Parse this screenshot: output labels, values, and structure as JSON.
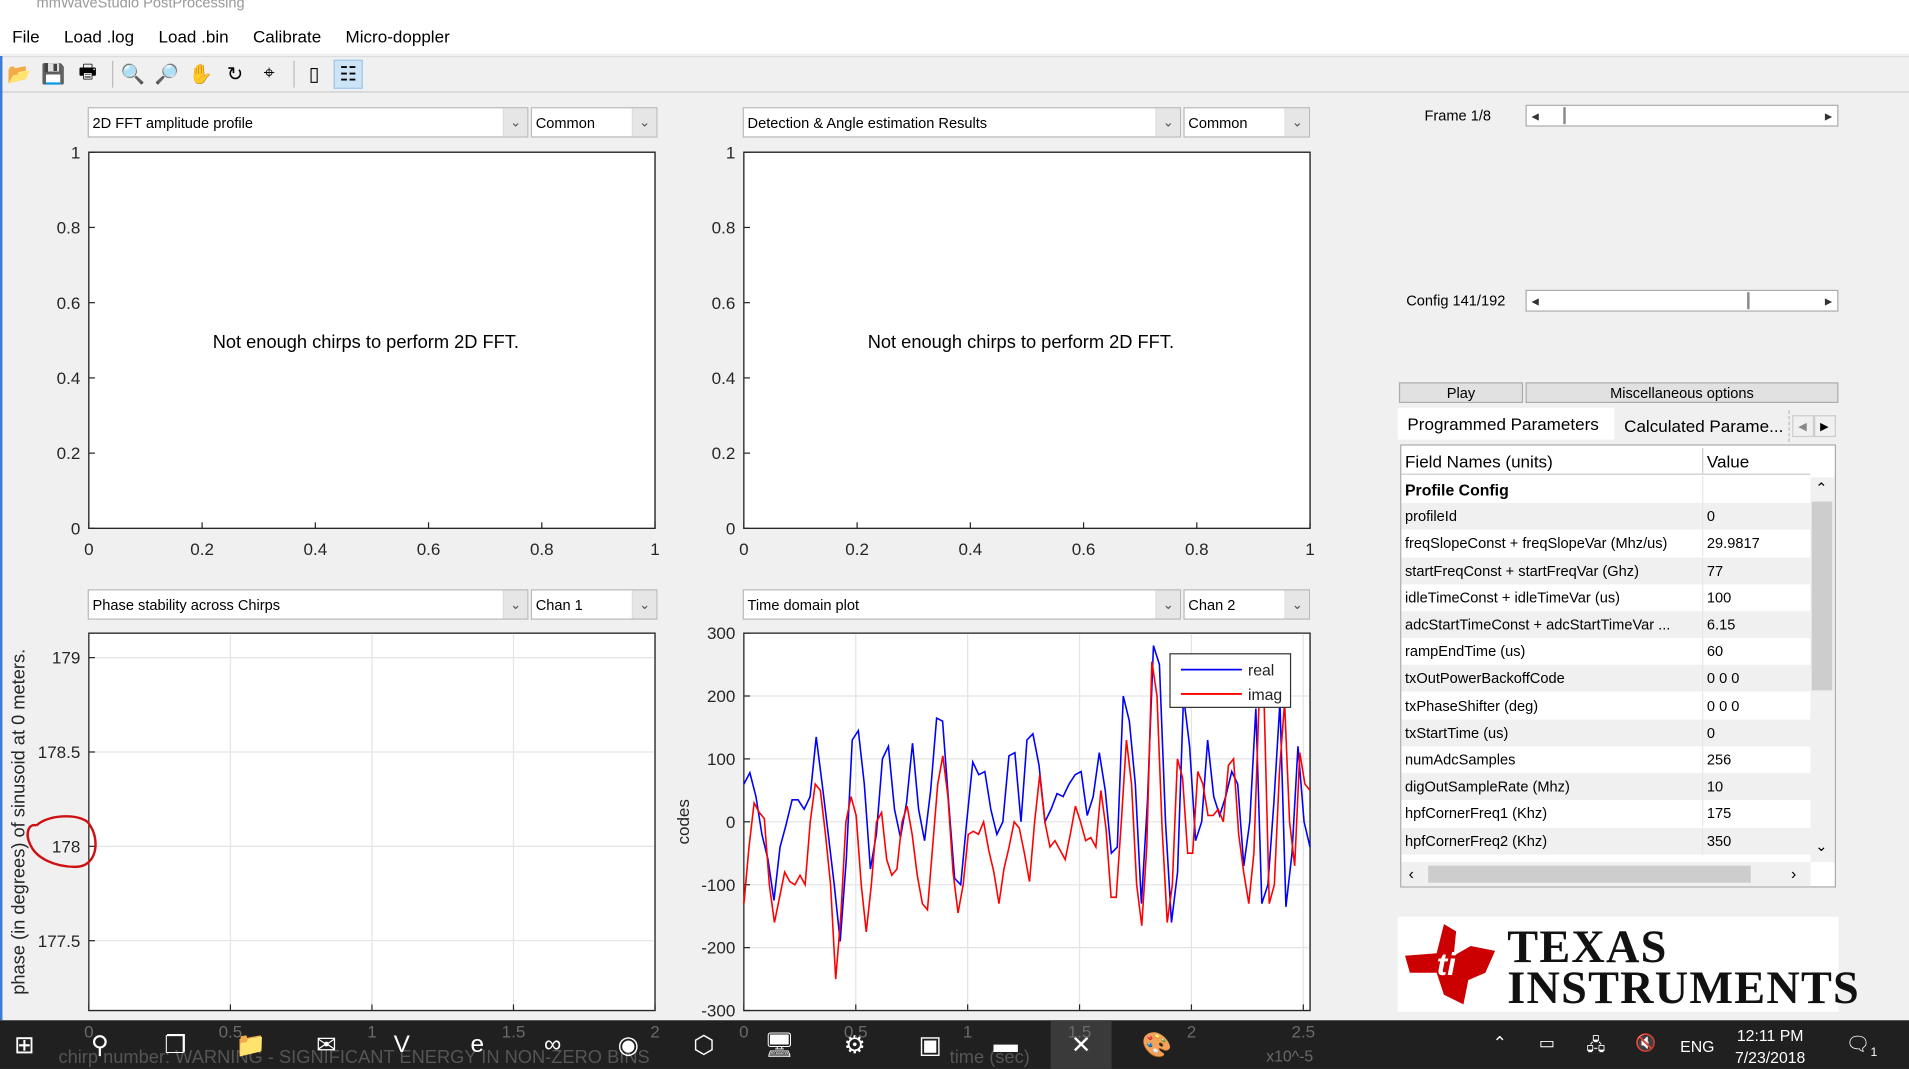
{
  "window": {
    "title": "mmWaveStudio PostProcessing"
  },
  "menu": [
    "File",
    "Load .log",
    "Load .bin",
    "Calibrate",
    "Micro-doppler"
  ],
  "toolbar": [
    {
      "icon": "open-folder-icon",
      "glyph": "📂"
    },
    {
      "icon": "save-icon",
      "glyph": "💾"
    },
    {
      "icon": "print-icon",
      "glyph": "🖶"
    },
    {
      "icon": "zoom-in-icon",
      "glyph": "🔍"
    },
    {
      "icon": "zoom-out-icon",
      "glyph": "🔎"
    },
    {
      "icon": "pan-hand-icon",
      "glyph": "✋"
    },
    {
      "icon": "rotate-icon",
      "glyph": "↻"
    },
    {
      "icon": "data-cursor-icon",
      "glyph": "⌖"
    },
    {
      "icon": "colorbar-icon",
      "glyph": "▯"
    },
    {
      "icon": "legend-icon",
      "glyph": "☷"
    }
  ],
  "panels": [
    {
      "select": "2D FFT amplitude profile",
      "option": "Common",
      "message": "Not enough chirps to perform 2D FFT.",
      "xticks": [
        "0",
        "0.2",
        "0.4",
        "0.6",
        "0.8",
        "1"
      ],
      "yticks": [
        "0",
        "0.2",
        "0.4",
        "0.6",
        "0.8",
        "1"
      ]
    },
    {
      "select": "Detection & Angle estimation Results",
      "option": "Common",
      "message": "Not enough chirps to perform 2D FFT.",
      "xticks": [
        "0",
        "0.2",
        "0.4",
        "0.6",
        "0.8",
        "1"
      ],
      "yticks": [
        "0",
        "0.2",
        "0.4",
        "0.6",
        "0.8",
        "1"
      ]
    },
    {
      "select": "Phase stability across Chirps",
      "option": "Chan 1",
      "ylabel": "phase (in degrees) of sinusoid at 0  meters.",
      "xlabel": "chirp number: WARNING - SIGNIFICANT ENERGY IN NON-ZERO BINS",
      "xticks": [
        "0",
        "0.5",
        "1",
        "1.5",
        "2"
      ],
      "yticks": [
        "177.5",
        "178",
        "178.5",
        "179"
      ]
    },
    {
      "select": "Time domain plot",
      "option": "Chan 2",
      "ylabel": "codes",
      "xlabel": "time (sec)",
      "exponent": "x10^-5"
    }
  ],
  "chart_data": [
    {
      "type": "line",
      "ylim": [
        0,
        1
      ],
      "xlim": [
        0,
        1
      ],
      "series": [],
      "annotation": "Not enough chirps to perform 2D FFT."
    },
    {
      "type": "line",
      "ylim": [
        0,
        1
      ],
      "xlim": [
        0,
        1
      ],
      "series": [],
      "annotation": "Not enough chirps to perform 2D FFT."
    },
    {
      "type": "line",
      "xlim": [
        0,
        2
      ],
      "ylim": [
        177.13,
        179.13
      ],
      "grid": true,
      "ylabel": "phase (in degrees) of sinusoid at 0  meters.",
      "xlabel": "chirp number: WARNING - SIGNIFICANT ENERGY IN NON-ZERO BINS",
      "series": [],
      "highlight": "red hand-drawn circle around 178 tick"
    },
    {
      "type": "line",
      "xlim": [
        0,
        2.53
      ],
      "ylim": [
        -300,
        300
      ],
      "grid": true,
      "ylabel": "codes",
      "xlabel": "time (sec)",
      "x_scale_note": "x10^-5",
      "yticks": [
        -300,
        -200,
        -100,
        0,
        100,
        200,
        300
      ],
      "xticks": [
        0,
        0.5,
        1,
        1.5,
        2,
        2.5
      ],
      "legend": "top-right",
      "series": [
        {
          "name": "real",
          "color": "#0000ff",
          "values": [
            60,
            78,
            40,
            -20,
            -60,
            -125,
            -40,
            -5,
            35,
            35,
            20,
            40,
            135,
            60,
            -20,
            -100,
            -190,
            -60,
            130,
            145,
            60,
            -75,
            -20,
            100,
            120,
            20,
            -25,
            30,
            125,
            20,
            -30,
            50,
            165,
            160,
            30,
            -90,
            -100,
            0,
            95,
            75,
            80,
            20,
            -20,
            0,
            105,
            110,
            0,
            130,
            140,
            90,
            0,
            20,
            45,
            40,
            60,
            75,
            80,
            10,
            40,
            110,
            50,
            -50,
            -40,
            200,
            160,
            60,
            -130,
            30,
            280,
            250,
            0,
            -160,
            -80,
            200,
            120,
            -30,
            0,
            130,
            40,
            10,
            40,
            80,
            60,
            -70,
            0,
            180,
            -130,
            -100,
            30,
            190,
            -135,
            -50,
            120,
            0,
            -40
          ]
        },
        {
          "name": "imag",
          "color": "#ff0000",
          "values": [
            -130,
            -40,
            30,
            15,
            5,
            -100,
            -160,
            -120,
            -80,
            -95,
            -100,
            -85,
            -100,
            0,
            60,
            50,
            -20,
            -100,
            -250,
            -150,
            0,
            40,
            10,
            -100,
            -175,
            -100,
            0,
            15,
            -60,
            -85,
            -75,
            0,
            25,
            -20,
            -85,
            -130,
            -140,
            -40,
            60,
            105,
            40,
            -80,
            -145,
            -100,
            -20,
            -15,
            -20,
            0,
            -45,
            -80,
            -130,
            -75,
            -40,
            0,
            -10,
            -50,
            -95,
            0,
            75,
            0,
            -40,
            -30,
            -45,
            -60,
            -20,
            25,
            0,
            -30,
            -25,
            -40,
            50,
            -10,
            -120,
            -120,
            0,
            130,
            60,
            -100,
            -165,
            -40,
            255,
            200,
            -10,
            -160,
            -100,
            100,
            70,
            -50,
            -50,
            80,
            60,
            10,
            10,
            20,
            0,
            90,
            100,
            -20,
            -80,
            -130,
            -50,
            190,
            190,
            -130,
            -100,
            80,
            190,
            0,
            -70,
            110,
            60,
            50
          ]
        }
      ]
    }
  ],
  "right": {
    "frame_label": "Frame 1/8",
    "frame_value": 1,
    "frame_max": 8,
    "config_label": "Config 141/192",
    "config_value": 141,
    "config_max": 192,
    "play": "Play",
    "misc": "Miscellaneous options",
    "tabs": [
      "Programmed Parameters",
      "Calculated Parame..."
    ],
    "table": {
      "headers": [
        "Field Names    (units)",
        "Value"
      ],
      "rows": [
        [
          "Profile Config",
          ""
        ],
        [
          "profileId",
          "0"
        ],
        [
          "freqSlopeConst + freqSlopeVar (Mhz/us)",
          "29.9817"
        ],
        [
          "startFreqConst + startFreqVar (Ghz)",
          "77"
        ],
        [
          "idleTimeConst + idleTimeVar (us)",
          "100"
        ],
        [
          "adcStartTimeConst + adcStartTimeVar ...",
          "6.15"
        ],
        [
          "rampEndTime (us)",
          "60"
        ],
        [
          "txOutPowerBackoffCode",
          "0 0 0"
        ],
        [
          "txPhaseShifter (deg)",
          "0 0 0"
        ],
        [
          "txStartTime (us)",
          "0"
        ],
        [
          "numAdcSamples",
          "256"
        ],
        [
          "digOutSampleRate (Mhz)",
          "10"
        ],
        [
          "hpfCornerFreq1 (Khz)",
          "175"
        ],
        [
          "hpfCornerFreq2 (Khz)",
          "350"
        ]
      ]
    },
    "logo": {
      "line1": "TEXAS",
      "line2": "INSTRUMENTS",
      "color": "#cc0000"
    }
  },
  "taskbar": {
    "apps": [
      "windows-start-icon",
      "search-icon",
      "task-view-icon",
      "file-explorer-icon",
      "outlook-icon",
      "visio-icon",
      "internet-explorer-icon",
      "visual-studio-icon",
      "chrome-icon",
      "package-icon",
      "matlab-installer-icon",
      "settings-gear-icon",
      "control-panel-icon",
      "terminal-icon",
      "mmwave-tool-icon",
      "paint-icon"
    ],
    "lang": "ENG",
    "time": "12:11 PM",
    "date": "7/23/2018",
    "notifications": "1"
  }
}
